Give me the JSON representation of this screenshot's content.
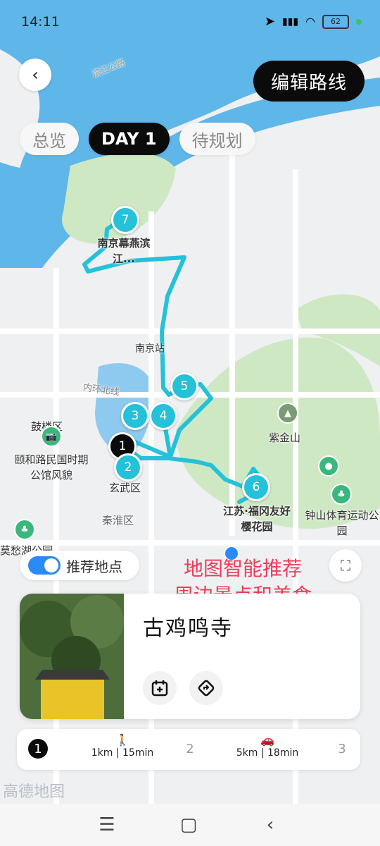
{
  "status": {
    "time": "14:11",
    "battery": "62"
  },
  "header": {
    "edit_route": "编辑路线"
  },
  "tabs": [
    {
      "label": "总览"
    },
    {
      "label": "DAY 1"
    },
    {
      "label": "待规划"
    }
  ],
  "map": {
    "labels": {
      "road_top": "滨江公路",
      "nanjing_station": "南京站",
      "ring_road": "内环北线",
      "gulou": "鼓楼区",
      "yihe_road": "颐和路民国时期公馆风貌",
      "xuanwu": "玄武区",
      "qinhuai": "秦淮区",
      "zijinshan": "紫金山",
      "zhongshan_stadium": "钟山体育运动公园",
      "mochou_lake": "莫愁湖公园",
      "stop7_name": "南京幕燕滨江...",
      "stop6_name": "江苏·福冈友好樱花园"
    },
    "markers": [
      "1",
      "2",
      "3",
      "4",
      "5",
      "6",
      "7"
    ]
  },
  "recommend": {
    "label": "推荐地点",
    "enabled": true
  },
  "promo_text": [
    "地图智能推荐",
    "周边景点和美食"
  ],
  "card": {
    "title": "古鸡鸣寺"
  },
  "steps": {
    "items": [
      {
        "num": "1"
      },
      {
        "mode": "walk-icon",
        "text": "1km | 15min"
      },
      {
        "num": "2"
      },
      {
        "mode": "car-icon",
        "text": "5km | 18min"
      },
      {
        "num": "3"
      }
    ]
  },
  "watermark": "高德地图",
  "colors": {
    "route": "#25c1d8",
    "accent": "#2a8af6",
    "promo": "#f03b5a",
    "park": "#cfe8c4",
    "water": "#5fb6e8"
  }
}
